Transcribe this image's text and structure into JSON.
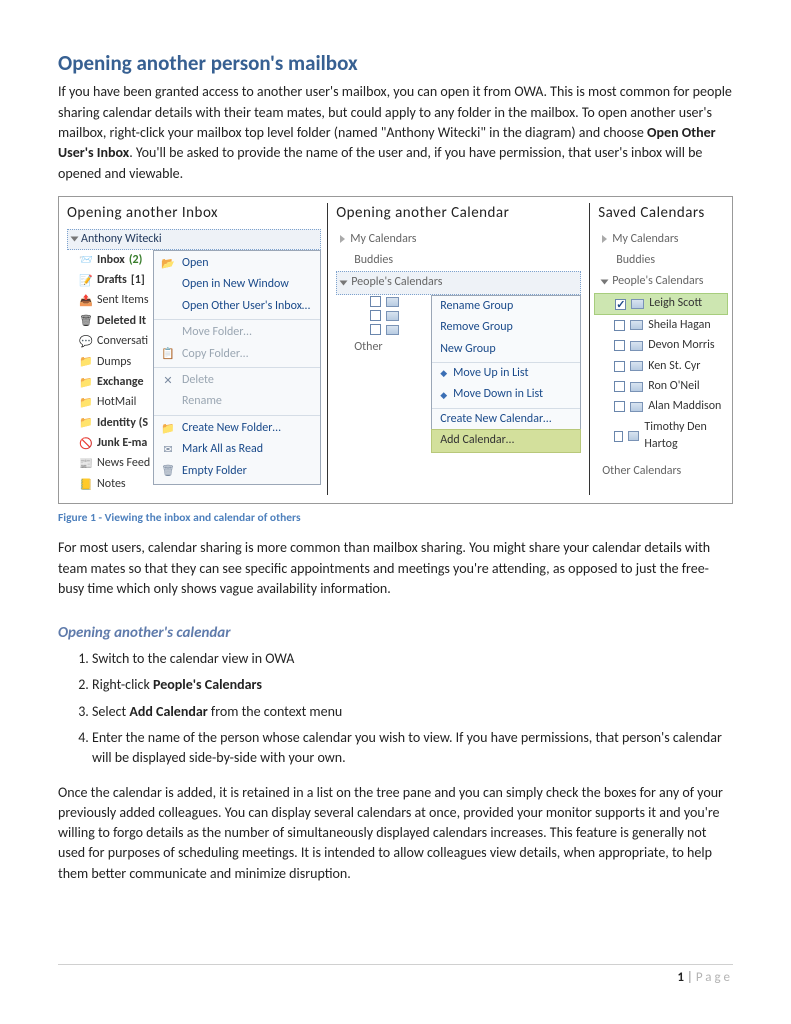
{
  "title": "Opening another person's mailbox",
  "intro_parts": {
    "p1a": "If you have been granted access to another user's mailbox, you can open it from OWA. This is most common for people sharing calendar details with their team mates, but could apply to any folder in the mailbox. To open another user's mailbox, right-click your mailbox top level folder (named \"Anthony Witecki\" in the diagram) and choose ",
    "p1b_bold": "Open Other User's Inbox",
    "p1c": ". You'll be asked to provide the name of the user and, if you have permission, that user's inbox will be opened and viewable."
  },
  "figure": {
    "col1_title": "Opening  another  Inbox",
    "col2_title": "Opening  another  Calendar",
    "col3_title": "Saved  Calendars",
    "tree_root": "Anthony Witecki",
    "inbox_tree": [
      {
        "label": "Inbox",
        "suffix": "(2)",
        "bold": true,
        "icon": "📨"
      },
      {
        "label": "Drafts",
        "suffix": "[1]",
        "bold": true,
        "icon": "📝"
      },
      {
        "label": "Sent Items",
        "icon": "📤"
      },
      {
        "label": "Deleted It",
        "bold": true,
        "icon": "🗑"
      },
      {
        "label": "Conversati",
        "icon": "💬"
      },
      {
        "label": "Dumps",
        "icon": "📁"
      },
      {
        "label": "Exchange",
        "bold": true,
        "icon": "📁"
      },
      {
        "label": "HotMail",
        "icon": "📁"
      },
      {
        "label": "Identity (S",
        "bold": true,
        "icon": "📁"
      },
      {
        "label": "Junk E-ma",
        "bold": true,
        "icon": "🚫"
      },
      {
        "label": "News Feed",
        "icon": "📰"
      },
      {
        "label": "Notes",
        "icon": "📒"
      }
    ],
    "inbox_menu": [
      {
        "label": "Open",
        "icon": "📂"
      },
      {
        "label": "Open in New Window",
        "icon": ""
      },
      {
        "label": "Open Other User's Inbox…",
        "icon": ""
      },
      {
        "label": "Move Folder…",
        "icon": "",
        "sep": true,
        "disabled": true
      },
      {
        "label": "Copy Folder…",
        "icon": "📋",
        "disabled": true
      },
      {
        "label": "Delete",
        "icon": "✕",
        "sep": true,
        "disabled": true
      },
      {
        "label": "Rename",
        "icon": "",
        "disabled": true
      },
      {
        "label": "Create New Folder…",
        "icon": "📁",
        "sep": true
      },
      {
        "label": "Mark All as Read",
        "icon": "✉"
      },
      {
        "label": "Empty Folder",
        "icon": "🗑"
      }
    ],
    "cal_sections": [
      {
        "label": "My Calendars",
        "expand": false
      },
      {
        "label": "Buddies",
        "indent": true
      },
      {
        "label": "People's Calendars",
        "expand": true,
        "active": true
      }
    ],
    "cal_checks_left": [
      "",
      "",
      ""
    ],
    "cal_other": "Other",
    "cal_context": [
      {
        "label": "Rename Group"
      },
      {
        "label": "Remove Group"
      },
      {
        "label": "New Group"
      },
      {
        "label": "Move Up in List",
        "sep": true,
        "icon": "◆"
      },
      {
        "label": "Move Down in List",
        "icon": "◆"
      },
      {
        "label": "Create New Calendar…",
        "sep": true
      },
      {
        "label": "Add Calendar…",
        "hl": true,
        "sep": true
      }
    ],
    "saved_sections": {
      "my": "My Calendars",
      "buddies": "Buddies",
      "people": "People's Calendars",
      "other": "Other Calendars"
    },
    "saved_people": [
      {
        "name": "Leigh Scott",
        "checked": true,
        "hl": true
      },
      {
        "name": "Sheila Hagan"
      },
      {
        "name": "Devon Morris"
      },
      {
        "name": "Ken St. Cyr"
      },
      {
        "name": "Ron O'Neil"
      },
      {
        "name": "Alan Maddison"
      },
      {
        "name": "Timothy Den Hartog"
      }
    ]
  },
  "caption": "Figure 1 - Viewing the inbox and calendar of others",
  "para2": "For most users, calendar sharing is more common than mailbox sharing. You might share your calendar details with team mates so that they can see specific appointments and meetings you're attending, as opposed to just the free-busy time which only shows vague availability information.",
  "subhead": "Opening another's calendar",
  "steps": {
    "s1": "Switch to the calendar view in OWA",
    "s2a": "Right-click ",
    "s2b_bold": "People's Calendars",
    "s3a": "Select ",
    "s3b_bold": "Add Calendar",
    "s3c": " from the context menu",
    "s4": "Enter the name of the person whose calendar you wish to view. If you have permissions, that person's calendar will be displayed side-by-side with your own."
  },
  "para3": "Once the calendar is added, it is retained in a list on the tree pane and you can simply check the boxes for any of your previously added colleagues. You can display several calendars at once, provided your monitor supports it and you're willing to forgo details as the number of simultaneously displayed calendars increases. This feature is generally not used for purposes of scheduling meetings. It is intended to allow colleagues view details, when appropriate, to help them better communicate and minimize disruption.",
  "footer": {
    "num": "1",
    "sep": " | ",
    "word": "Page"
  }
}
